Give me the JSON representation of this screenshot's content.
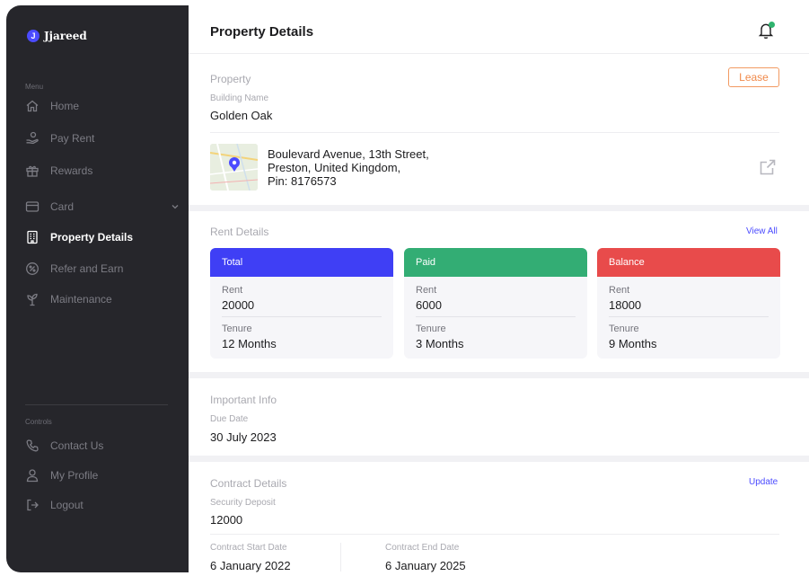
{
  "brand": {
    "badge": "J",
    "name": "Jjareed"
  },
  "sidebar": {
    "menu_label": "Menu",
    "items": [
      {
        "label": "Home",
        "icon": "home-icon"
      },
      {
        "label": "Pay Rent",
        "icon": "hand-coin-icon"
      },
      {
        "label": "Rewards",
        "icon": "gift-icon"
      },
      {
        "label": "Card",
        "icon": "card-icon"
      },
      {
        "label": "Property Details",
        "icon": "building-icon",
        "active": true
      },
      {
        "label": "Refer and Earn",
        "icon": "percent-badge-icon"
      },
      {
        "label": "Maintenance",
        "icon": "plant-icon"
      }
    ],
    "controls_label": "Controls",
    "controls": [
      {
        "label": "Contact Us",
        "icon": "phone-icon"
      },
      {
        "label": "My Profile",
        "icon": "user-icon"
      },
      {
        "label": "Logout",
        "icon": "logout-icon"
      }
    ]
  },
  "header": {
    "title": "Property Details"
  },
  "property": {
    "section_title": "Property",
    "badge": "Lease",
    "building_label": "Building Name",
    "building_value": "Golden Oak",
    "address_line1": "Boulevard Avenue, 13th Street,",
    "address_line2": "Preston, United Kingdom,",
    "address_line3": "Pin: 8176573"
  },
  "rent": {
    "section_title": "Rent Details",
    "view_all": "View All",
    "rent_label": "Rent",
    "tenure_label": "Tenure",
    "cards": [
      {
        "title": "Total",
        "rent": "20000",
        "tenure": "12 Months",
        "color": "#3f3ff5"
      },
      {
        "title": "Paid",
        "rent": "6000",
        "tenure": "3 Months",
        "color": "#33ad74"
      },
      {
        "title": "Balance",
        "rent": "18000",
        "tenure": "9 Months",
        "color": "#e84b4b"
      }
    ]
  },
  "important": {
    "section_title": "Important Info",
    "due_label": "Due Date",
    "due_value": "30 July 2023"
  },
  "contract": {
    "section_title": "Contract Details",
    "update": "Update",
    "deposit_label": "Security Deposit",
    "deposit_value": "12000",
    "start_label": "Contract Start Date",
    "start_value": "6 January 2022",
    "end_label": "Contract End Date",
    "end_value": "6 January 2025"
  },
  "colors": {
    "accent": "#4b4bff",
    "lease": "#f08a4b",
    "notification": "#2fb36e"
  }
}
